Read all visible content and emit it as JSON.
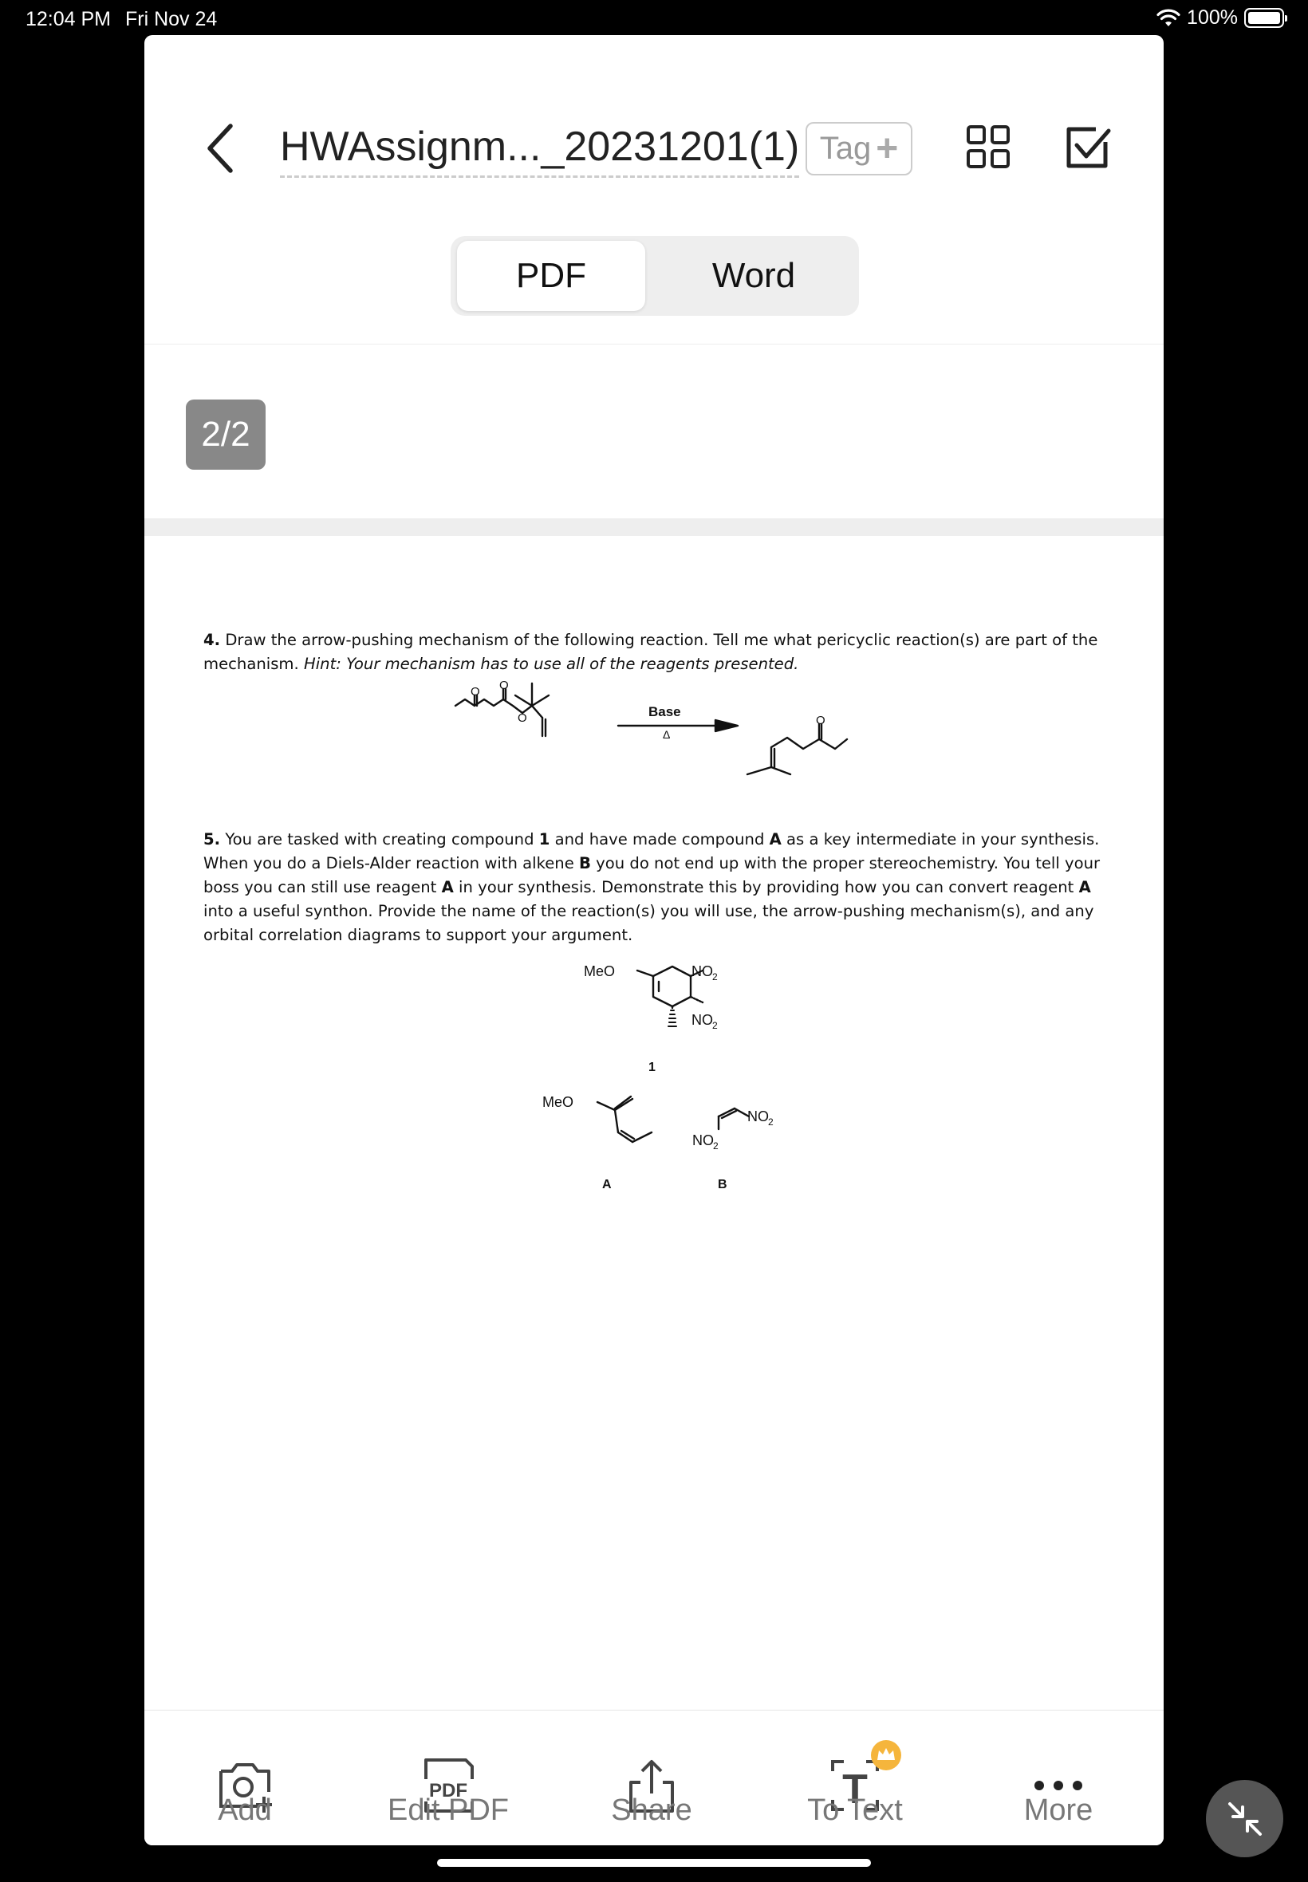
{
  "status_bar": {
    "time": "12:04 PM",
    "date": "Fri Nov 24",
    "battery": "100%"
  },
  "header": {
    "title": "HWAssignm..._20231201(1)",
    "tag_label": "Tag",
    "tabs": [
      {
        "label": "PDF",
        "selected": true
      },
      {
        "label": "Word",
        "selected": false
      }
    ]
  },
  "page_indicator": "2/2",
  "document": {
    "q4": {
      "number": "4.",
      "text": "Draw the arrow-pushing mechanism of the following reaction. Tell me what pericyclic reaction(s) are part of the mechanism.",
      "hint_label": "Hint:",
      "hint": "Your mechanism has to use all of the reagents presented.",
      "arrow_top": "Base",
      "arrow_bottom": "Δ"
    },
    "q5": {
      "number": "5.",
      "t1": "You are tasked with creating compound",
      "c1": "1",
      "t2": "and have made compound",
      "cA": "A",
      "t3": "as a key intermediate in your synthesis. When you do a Diels-Alder reaction with alkene",
      "cB": "B",
      "t4": "you do not end up with the proper stereochemistry. You tell your boss you can still use reagent",
      "cA2": "A",
      "t5": "in your synthesis. Demonstrate this by providing how you can convert reagent",
      "cA3": "A",
      "t6": "into a useful synthon. Provide the name of the reaction(s) you will use, the arrow-pushing mechanism(s), and any orbital correlation diagrams to support your argument."
    },
    "chem_labels": {
      "oxygen": "O",
      "meo": "MeO",
      "no2": "NO",
      "sub2": "2",
      "compound_1": "1",
      "compound_a": "A",
      "compound_b": "B"
    }
  },
  "toolbar": [
    {
      "label": "Add",
      "icon": "add-photo-icon"
    },
    {
      "label": "Edit PDF",
      "icon": "edit-pdf-icon",
      "icon_text": "PDF"
    },
    {
      "label": "Share",
      "icon": "share-icon"
    },
    {
      "label": "To Text",
      "icon": "to-text-icon",
      "icon_text": "T"
    },
    {
      "label": "More",
      "icon": "more-icon"
    }
  ],
  "colors": {
    "premium_badge": "#f5b53c",
    "page_badge": "#888888"
  }
}
